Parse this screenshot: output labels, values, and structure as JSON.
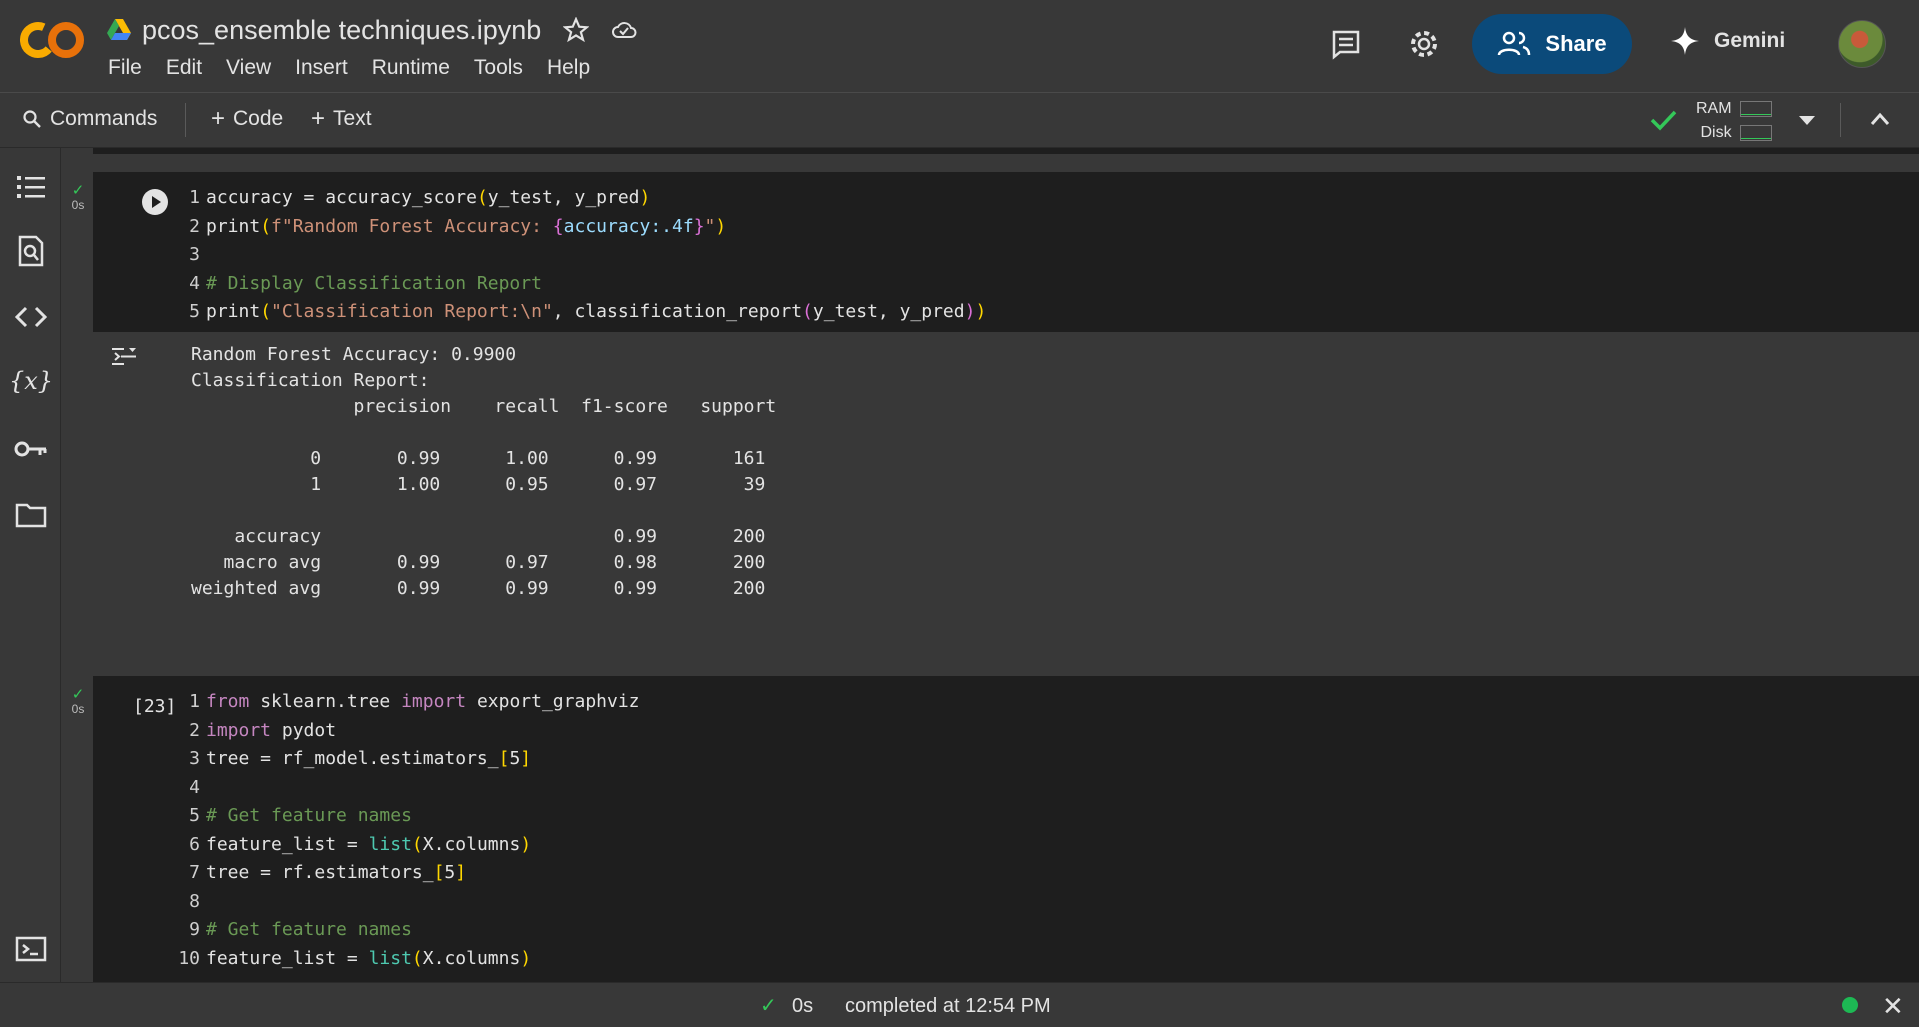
{
  "app": {
    "logo_text": "CO",
    "notebook_title": "pcos_ensemble techniques.ipynb",
    "menu": [
      "File",
      "Edit",
      "View",
      "Insert",
      "Runtime",
      "Tools",
      "Help"
    ],
    "share_label": "Share",
    "gemini_label": "Gemini"
  },
  "toolbar": {
    "commands_label": "Commands",
    "code_label": "Code",
    "text_label": "Text",
    "ram_label": "RAM",
    "disk_label": "Disk"
  },
  "colors": {
    "accent_green": "#34c759",
    "share_bg": "#0b4a7a",
    "cell_bg": "#1e1e1e",
    "page_bg": "#383838"
  },
  "cells": [
    {
      "status_time": "0s",
      "lines": [
        {
          "n": "1",
          "html": "accuracy = accuracy_score<span class=\"br1\">(</span>y_test, y_pred<span class=\"br1\">)</span>"
        },
        {
          "n": "2",
          "html": "print<span class=\"br1\">(</span><span class=\"str\">f\"Random Forest Accuracy: </span><span class=\"br2\">{</span><span class=\"fmt\">accuracy:.4f</span><span class=\"br2\">}</span><span class=\"str\">\"</span><span class=\"br1\">)</span>"
        },
        {
          "n": "3",
          "html": ""
        },
        {
          "n": "4",
          "html": "<span class=\"cm\"># Display Classification Report</span>"
        },
        {
          "n": "5",
          "html": "print<span class=\"br1\">(</span><span class=\"str\">\"Classification Report:\\n\"</span>, classification_report<span class=\"br2\">(</span>y_test, y_pred<span class=\"br2\">)</span><span class=\"br1\">)</span>"
        }
      ],
      "output": "Random Forest Accuracy: 0.9900\nClassification Report:\n               precision    recall  f1-score   support\n\n           0       0.99      1.00      0.99       161\n           1       1.00      0.95      0.97        39\n\n    accuracy                           0.99       200\n   macro avg       0.99      0.97      0.98       200\nweighted avg       0.99      0.99      0.99       200"
    },
    {
      "status_time": "0s",
      "exec_count": "[23]",
      "lines": [
        {
          "n": "1",
          "html": "<span class=\"kw\">from</span> sklearn.tree <span class=\"kw\">import</span> export_graphviz"
        },
        {
          "n": "2",
          "html": "<span class=\"kw\">import</span> pydot"
        },
        {
          "n": "3",
          "html": "tree = rf_model.estimators_<span class=\"br1\">[</span>5<span class=\"br1\">]</span>"
        },
        {
          "n": "4",
          "html": ""
        },
        {
          "n": "5",
          "html": "<span class=\"cm\"># Get feature names</span>"
        },
        {
          "n": "6",
          "html": "feature_list = <span class=\"fn\">list</span><span class=\"br1\">(</span>X.columns<span class=\"br1\">)</span>"
        },
        {
          "n": "7",
          "html": "tree = rf.estimators_<span class=\"br1\">[</span>5<span class=\"br1\">]</span>"
        },
        {
          "n": "8",
          "html": ""
        },
        {
          "n": "9",
          "html": "<span class=\"cm\"># Get feature names</span>"
        },
        {
          "n": "10",
          "html": "feature_list = <span class=\"fn\">list</span><span class=\"br1\">(</span>X.columns<span class=\"br1\">)</span>"
        }
      ]
    }
  ],
  "status": {
    "time": "0s",
    "completed": "completed at 12:54 PM"
  }
}
